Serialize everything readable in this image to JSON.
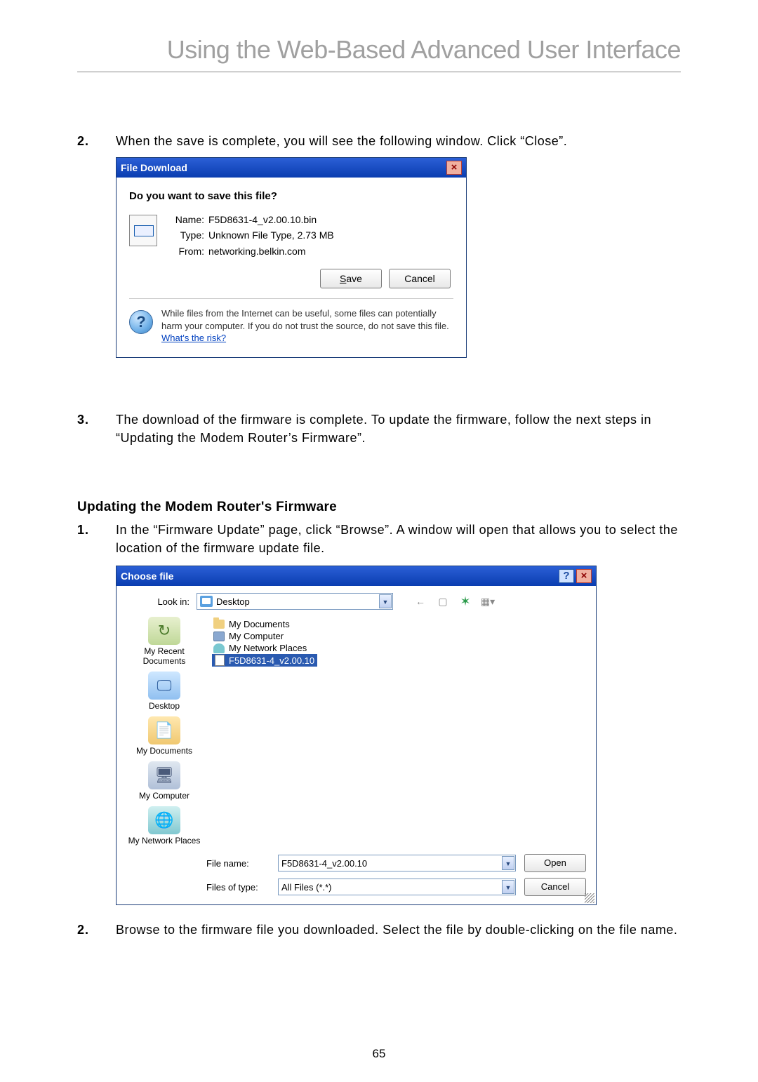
{
  "page": {
    "title": "Using the Web-Based Advanced User Interface",
    "number": "65"
  },
  "section": {
    "heading": "Updating the Modem Router's Firmware"
  },
  "steps_a": {
    "num2": "2.",
    "text2": "When the save is complete, you will see the following window. Click “Close”.",
    "num3": "3.",
    "text3": "The download of the firmware is complete. To update the firmware, follow the next steps in “Updating the Modem Router’s Firmware”."
  },
  "steps_b": {
    "num1": "1.",
    "text1": "In the “Firmware Update” page, click “Browse”. A window will open that allows you to select the location of the firmware update file.",
    "num2": "2.",
    "text2": "Browse to the firmware file you downloaded. Select the file by double-clicking on the file name."
  },
  "file_download": {
    "title": "File Download",
    "question": "Do you want to save this file?",
    "name_label": "Name:",
    "name_value": "F5D8631-4_v2.00.10.bin",
    "type_label": "Type:",
    "type_value": "Unknown File Type, 2.73 MB",
    "from_label": "From:",
    "from_value": "networking.belkin.com",
    "save_btn_prefix": "S",
    "save_btn_rest": "ave",
    "cancel_btn": "Cancel",
    "warn_text_a": "While files from the Internet can be useful, some files can potentially harm your computer. If you do not trust the source, do not save this file. ",
    "warn_link": "What's the risk?"
  },
  "choose_file": {
    "title": "Choose file",
    "lookin_label": "Look in:",
    "lookin_value": "Desktop",
    "places": {
      "recent": "My Recent Documents",
      "desktop": "Desktop",
      "mydocs": "My Documents",
      "mycomp": "My Computer",
      "mynet": "My Network Places"
    },
    "items": {
      "docs": "My Documents",
      "comp": "My Computer",
      "net": "My Network Places",
      "file": "F5D8631-4_v2.00.10"
    },
    "filename_label": "File name:",
    "filename_value": "F5D8631-4_v2.00.10",
    "filetype_label": "Files of type:",
    "filetype_value": "All Files (*.*)",
    "open_btn": "Open",
    "cancel_btn": "Cancel"
  }
}
